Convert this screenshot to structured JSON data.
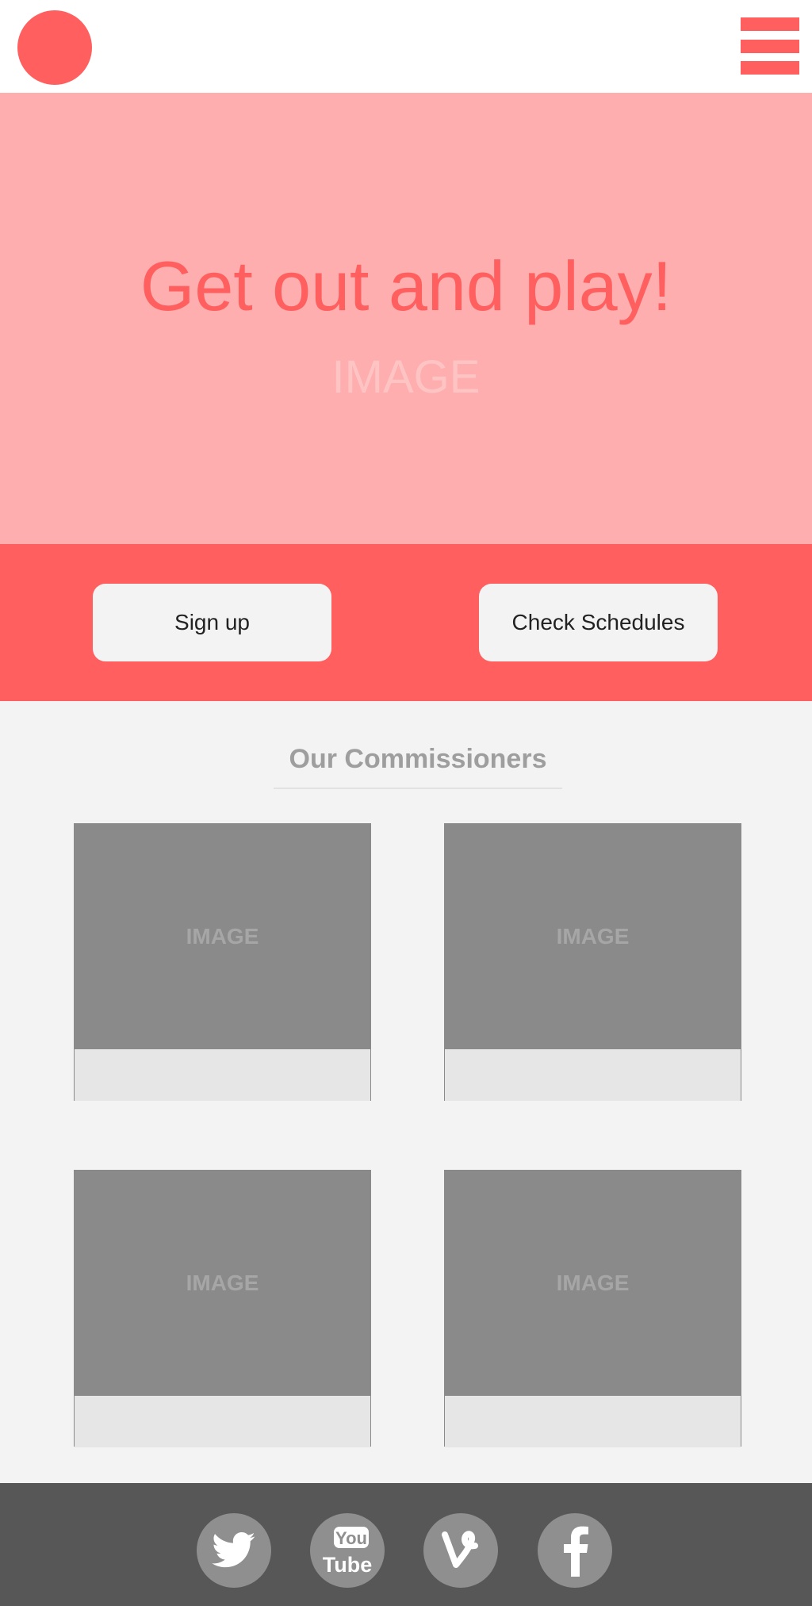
{
  "hero": {
    "title": "Get out and play!",
    "image_placeholder": "IMAGE"
  },
  "cta": {
    "signup_label": "Sign up",
    "schedules_label": "Check Schedules"
  },
  "commissioners": {
    "title": "Our Commissioners",
    "cards": [
      {
        "image_placeholder": "IMAGE"
      },
      {
        "image_placeholder": "IMAGE"
      },
      {
        "image_placeholder": "IMAGE"
      },
      {
        "image_placeholder": "IMAGE"
      }
    ]
  },
  "footer": {
    "social_icons": [
      "twitter-icon",
      "youtube-icon",
      "vine-icon",
      "facebook-icon"
    ],
    "youtube_text_top": "You",
    "youtube_text_bottom": "Tube"
  },
  "colors": {
    "accent": "#ff5f5f",
    "hero_bg": "#feaeae",
    "section_bg": "#f3f3f3",
    "footer_bg": "#575757",
    "icon_bg": "#8f8f8f"
  }
}
